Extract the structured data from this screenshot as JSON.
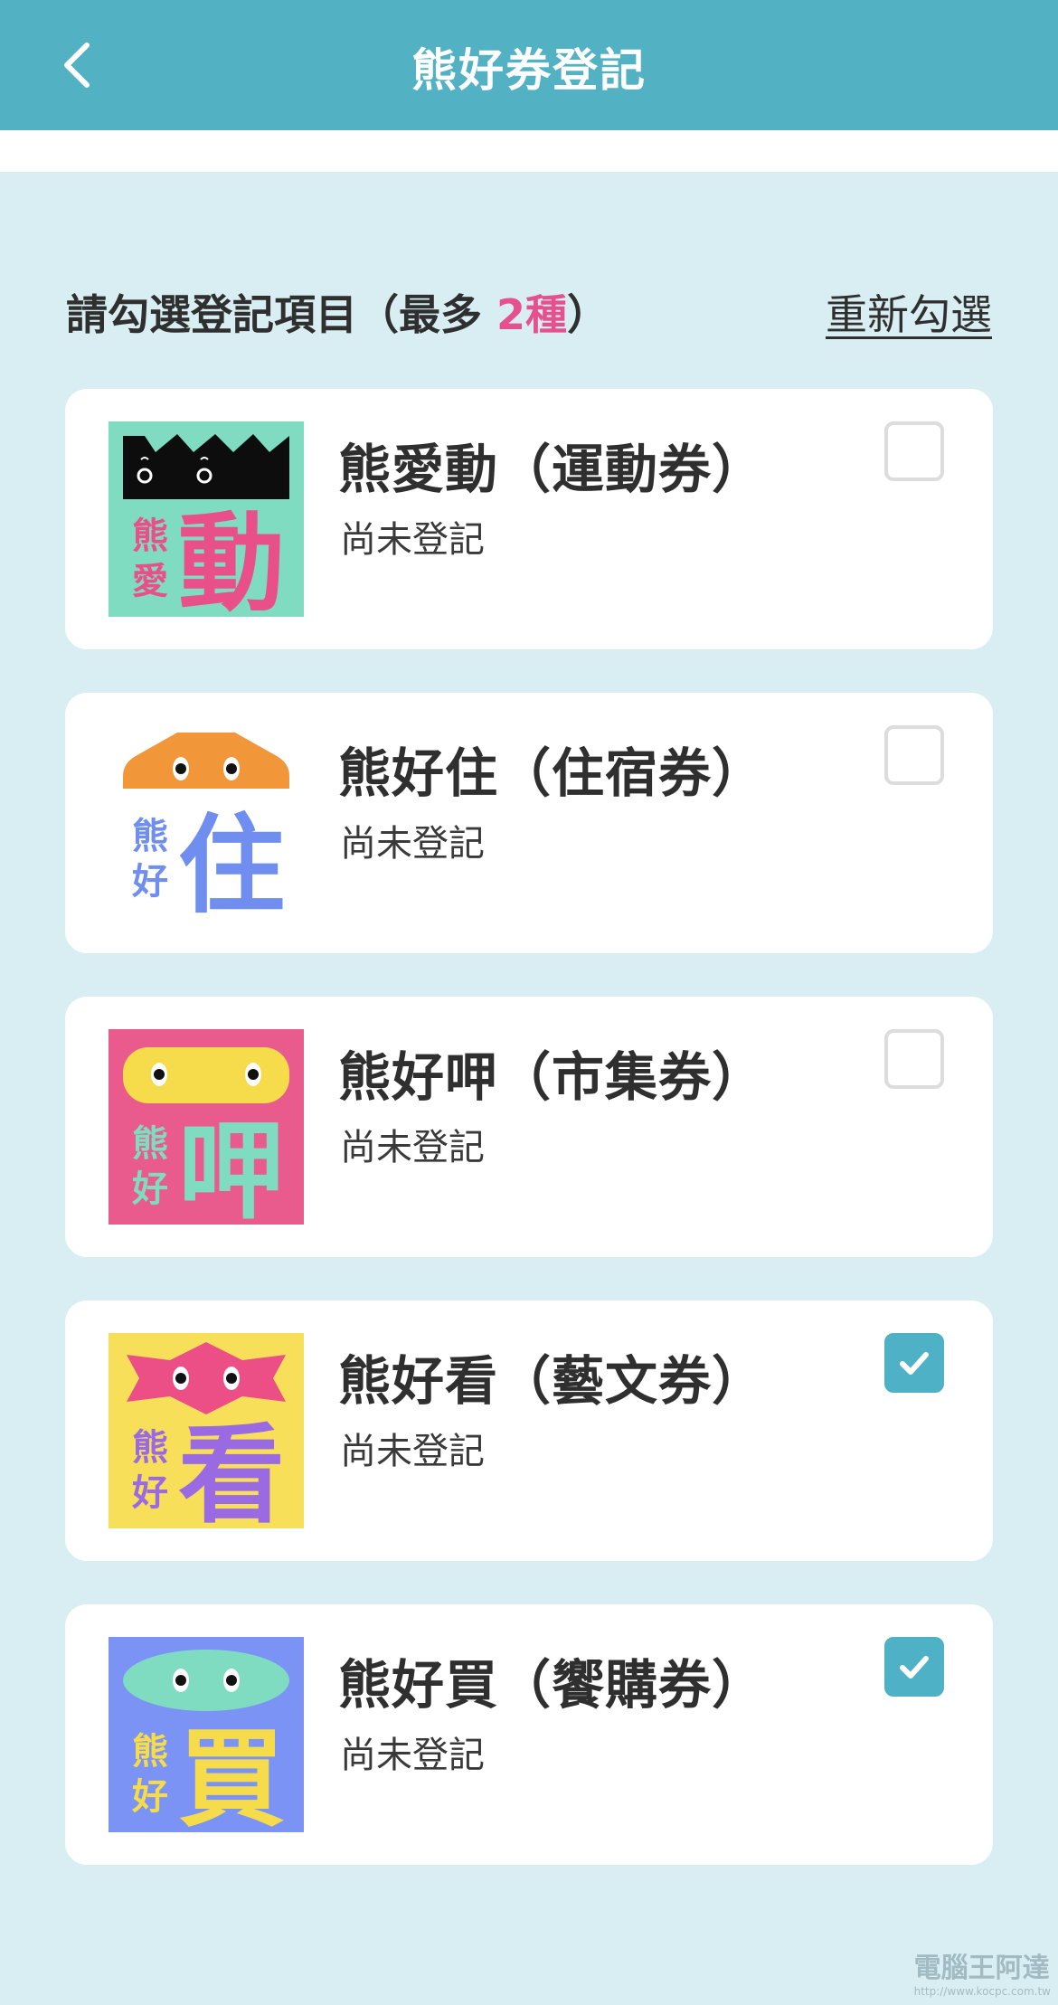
{
  "header": {
    "title": "熊好券登記",
    "back_icon": "chevron-left-icon"
  },
  "instruction": {
    "text_before": "請勾選登記項目（最多 ",
    "highlight": "2種",
    "text_after": "）",
    "highlight_color": "#e5508f"
  },
  "reset_label": "重新勾選",
  "items": [
    {
      "title": "熊愛動（運動券）",
      "status": "尚未登記",
      "checked": false,
      "icon": "sports-voucher-logo",
      "logo_text": [
        "熊",
        "愛",
        "動"
      ],
      "logo_bg": "#7fdcc0"
    },
    {
      "title": "熊好住（住宿券）",
      "status": "尚未登記",
      "checked": false,
      "icon": "lodging-voucher-logo",
      "logo_text": [
        "熊",
        "好",
        "住"
      ],
      "logo_bg": "#ffffff"
    },
    {
      "title": "熊好呷（市集券）",
      "status": "尚未登記",
      "checked": false,
      "icon": "market-voucher-logo",
      "logo_text": [
        "熊",
        "好",
        "呷"
      ],
      "logo_bg": "#ea5b8d"
    },
    {
      "title": "熊好看（藝文券）",
      "status": "尚未登記",
      "checked": true,
      "icon": "arts-voucher-logo",
      "logo_text": [
        "熊",
        "好",
        "看"
      ],
      "logo_bg": "#f8df5a"
    },
    {
      "title": "熊好買（饗購券）",
      "status": "尚未登記",
      "checked": true,
      "icon": "shopping-voucher-logo",
      "logo_text": [
        "熊",
        "好",
        "買"
      ],
      "logo_bg": "#7a93f5"
    }
  ],
  "watermark": {
    "text": "電腦王阿達",
    "url": "http://www.kocpc.com.tw"
  },
  "colors": {
    "header": "#52b1c3",
    "background": "#d9eef2",
    "checkbox_checked": "#4fb1c5"
  }
}
